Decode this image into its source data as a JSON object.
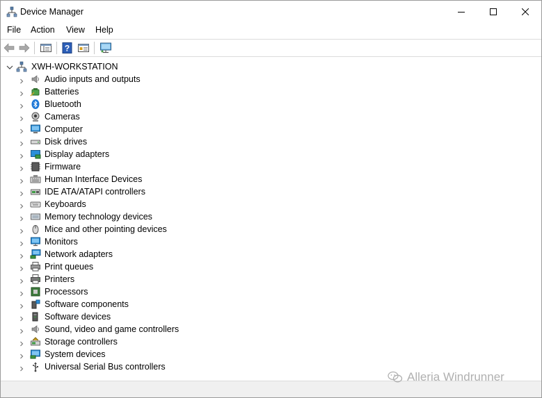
{
  "window": {
    "title": "Device Manager"
  },
  "menu": {
    "items": [
      "File",
      "Action",
      "View",
      "Help"
    ]
  },
  "tree": {
    "root": "XWH-WORKSTATION",
    "categories": [
      {
        "label": "Audio inputs and outputs",
        "icon": "speaker-icon"
      },
      {
        "label": "Batteries",
        "icon": "battery-icon"
      },
      {
        "label": "Bluetooth",
        "icon": "bluetooth-icon"
      },
      {
        "label": "Cameras",
        "icon": "camera-icon"
      },
      {
        "label": "Computer",
        "icon": "computer-icon"
      },
      {
        "label": "Disk drives",
        "icon": "disk-drive-icon"
      },
      {
        "label": "Display adapters",
        "icon": "display-adapter-icon"
      },
      {
        "label": "Firmware",
        "icon": "firmware-icon"
      },
      {
        "label": "Human Interface Devices",
        "icon": "hid-icon"
      },
      {
        "label": "IDE ATA/ATAPI controllers",
        "icon": "ide-controller-icon"
      },
      {
        "label": "Keyboards",
        "icon": "keyboard-icon"
      },
      {
        "label": "Memory technology devices",
        "icon": "memory-icon"
      },
      {
        "label": "Mice and other pointing devices",
        "icon": "mouse-icon"
      },
      {
        "label": "Monitors",
        "icon": "monitor-icon"
      },
      {
        "label": "Network adapters",
        "icon": "network-adapter-icon"
      },
      {
        "label": "Print queues",
        "icon": "print-queue-icon"
      },
      {
        "label": "Printers",
        "icon": "printer-icon"
      },
      {
        "label": "Processors",
        "icon": "processor-icon"
      },
      {
        "label": "Software components",
        "icon": "software-component-icon"
      },
      {
        "label": "Software devices",
        "icon": "software-device-icon"
      },
      {
        "label": "Sound, video and game controllers",
        "icon": "sound-controller-icon"
      },
      {
        "label": "Storage controllers",
        "icon": "storage-controller-icon"
      },
      {
        "label": "System devices",
        "icon": "system-device-icon"
      },
      {
        "label": "Universal Serial Bus controllers",
        "icon": "usb-icon"
      }
    ]
  },
  "watermark": {
    "text": "Alleria Windrunner"
  },
  "colors": {
    "accent_blue": "#1e78d7",
    "chevron": "#7a7a7a",
    "text": "#000000"
  }
}
